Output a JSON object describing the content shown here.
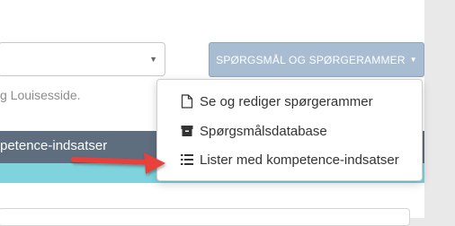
{
  "header": {
    "menu_button_label": "SPØRGSMÅL OG SPØRGERAMMER"
  },
  "page": {
    "hint_text": "g Louisesside.",
    "section_title": "petence-indsatser"
  },
  "menu": {
    "items": [
      {
        "label": "Se og rediger spørgerammer",
        "icon": "file-icon"
      },
      {
        "label": "Spørgsmålsdatabase",
        "icon": "archive-box-icon"
      },
      {
        "label": "Lister med kompetence-indsatser",
        "icon": "list-icon"
      }
    ]
  },
  "colors": {
    "button_bg": "#a9bdd2",
    "section_bar": "#5f6e7f",
    "teal_bar": "#7ed3dc",
    "arrow": "#e8413a"
  }
}
